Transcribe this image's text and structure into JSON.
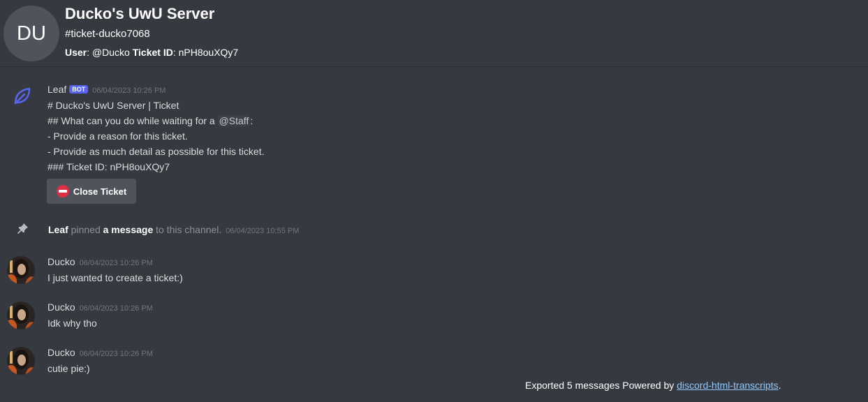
{
  "header": {
    "avatar_initials": "DU",
    "server_name": "Ducko's UwU Server",
    "channel_name": "#ticket-ducko7068",
    "user_label": "User",
    "user_value": ": @Ducko ",
    "ticket_label": "Ticket ID",
    "ticket_value": ": nPH8ouXQy7"
  },
  "bot_message": {
    "author": "Leaf",
    "bot_tag": "BOT",
    "timestamp": "06/04/2023 10:26 PM",
    "lines": {
      "line1": "# Ducko's UwU Server | Ticket",
      "line2_prefix": "## What can you do while waiting for a ",
      "line2_mention": "@Staff",
      "line2_suffix": ":",
      "line3": "- Provide a reason for this ticket.",
      "line4": "- Provide as much detail as possible for this ticket.",
      "line5": "### Ticket ID: nPH8ouXQy7"
    },
    "button_label": "Close Ticket",
    "button_icon": "no-entry-icon"
  },
  "system_message": {
    "author": "Leaf",
    "text1": " pinned ",
    "target": "a message",
    "text2": " to this channel.",
    "timestamp": "06/04/2023 10:55 PM",
    "icon": "pin-icon"
  },
  "messages": [
    {
      "author": "Ducko",
      "timestamp": "06/04/2023 10:26 PM",
      "content": "I just wanted to create a ticket:)"
    },
    {
      "author": "Ducko",
      "timestamp": "06/04/2023 10:26 PM",
      "content": "Idk why tho"
    },
    {
      "author": "Ducko",
      "timestamp": "06/04/2023 10:26 PM",
      "content": "cutie pie:)"
    }
  ],
  "footer": {
    "text": "Exported 5 messages Powered by ",
    "link": "discord-html-transcripts",
    "suffix": "."
  },
  "colors": {
    "background": "#36393f",
    "bot_tag": "#5865f2",
    "leaf_icon": "#5865f2",
    "button": "#4f545c",
    "link": "#00aff4"
  }
}
